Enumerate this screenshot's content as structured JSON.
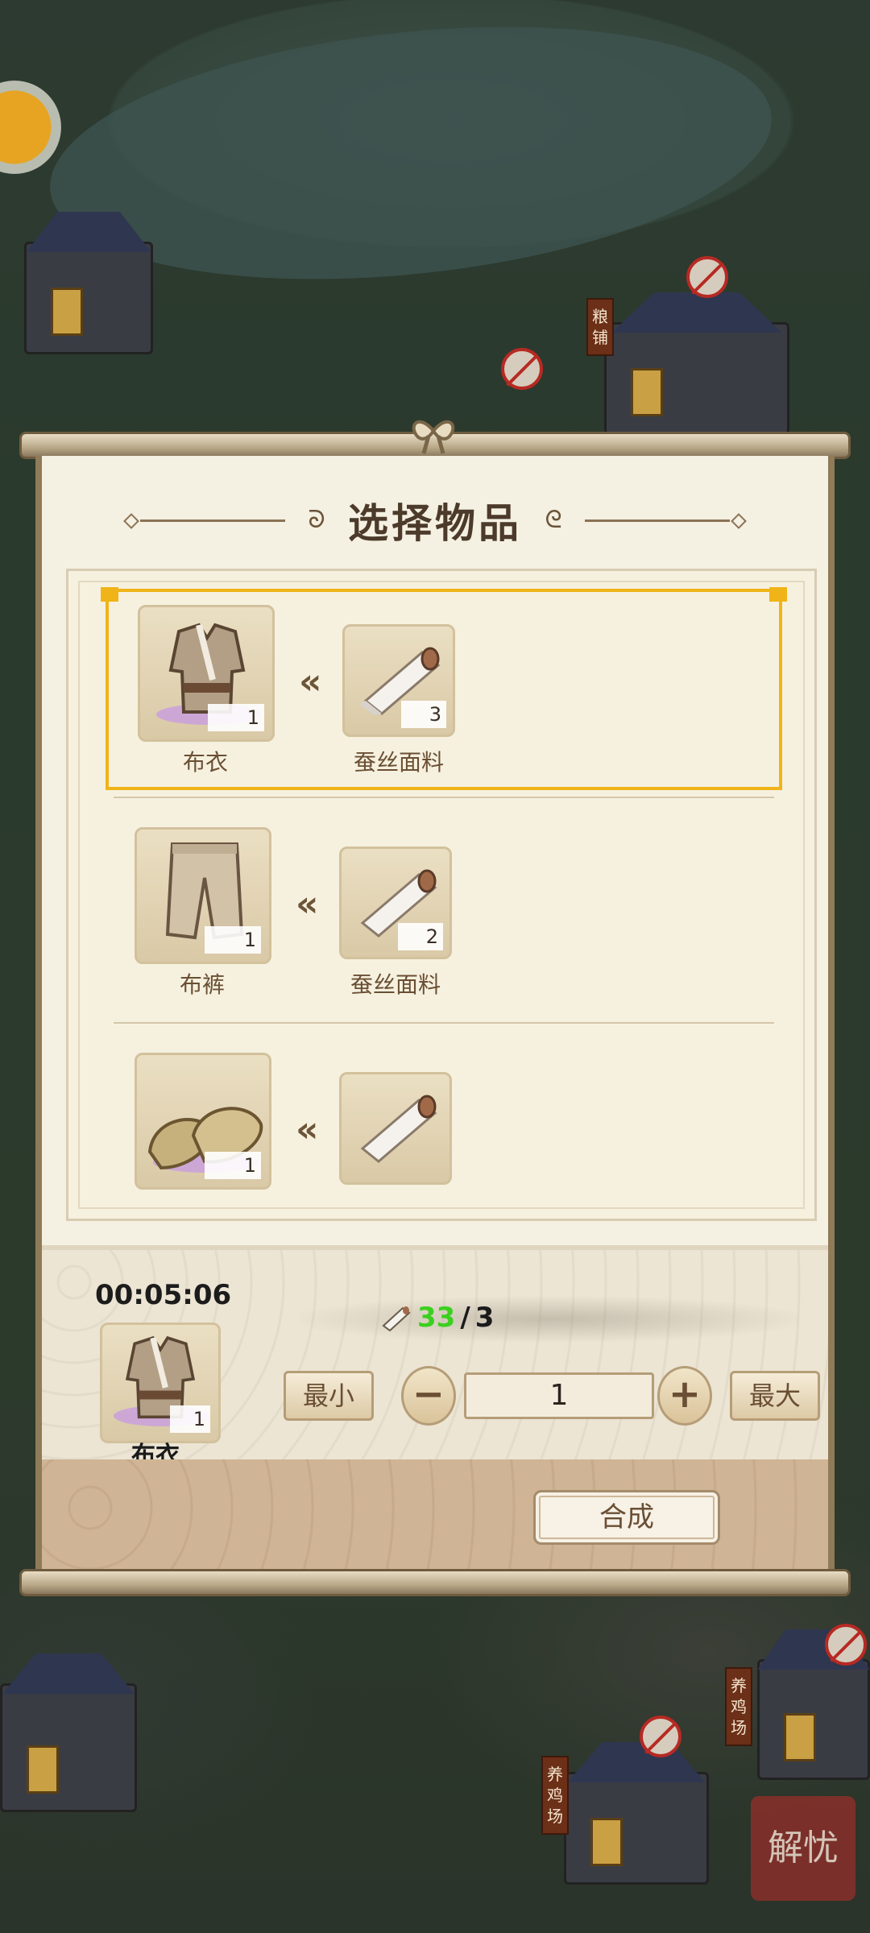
{
  "dialog": {
    "title": "选择物品"
  },
  "recipes": [
    {
      "product": "布衣",
      "product_count": "1",
      "material": "蚕丝面料",
      "material_count": "3"
    },
    {
      "product": "布裤",
      "product_count": "1",
      "material": "蚕丝面料",
      "material_count": "2"
    },
    {
      "product": "",
      "product_count": "1",
      "material": "",
      "material_count": ""
    }
  ],
  "selected": {
    "timer": "00:05:06",
    "name": "布衣",
    "count": "1",
    "requirement_have": "33",
    "requirement_sep": "/",
    "requirement_need": "3"
  },
  "controls": {
    "min_label": "最小",
    "max_label": "最大",
    "decrement": "−",
    "increment": "+",
    "quantity": "1",
    "craft_label": "合成"
  },
  "map_labels": {
    "granary": "粮铺",
    "chicken_farm_1": "养鸡场",
    "chicken_farm_2": "养鸡场",
    "corner_stamp": "解忧"
  },
  "colors": {
    "selected_border": "#f0b418",
    "have_count": "#3bd01f",
    "panel_bg": "#f4f0e2"
  },
  "icons": [
    "coin-icon",
    "no-entry-icon",
    "cloth-shirt-icon",
    "silk-roll-icon",
    "cloth-pants-icon",
    "straw-shoes-icon",
    "chevron-left-icon"
  ]
}
